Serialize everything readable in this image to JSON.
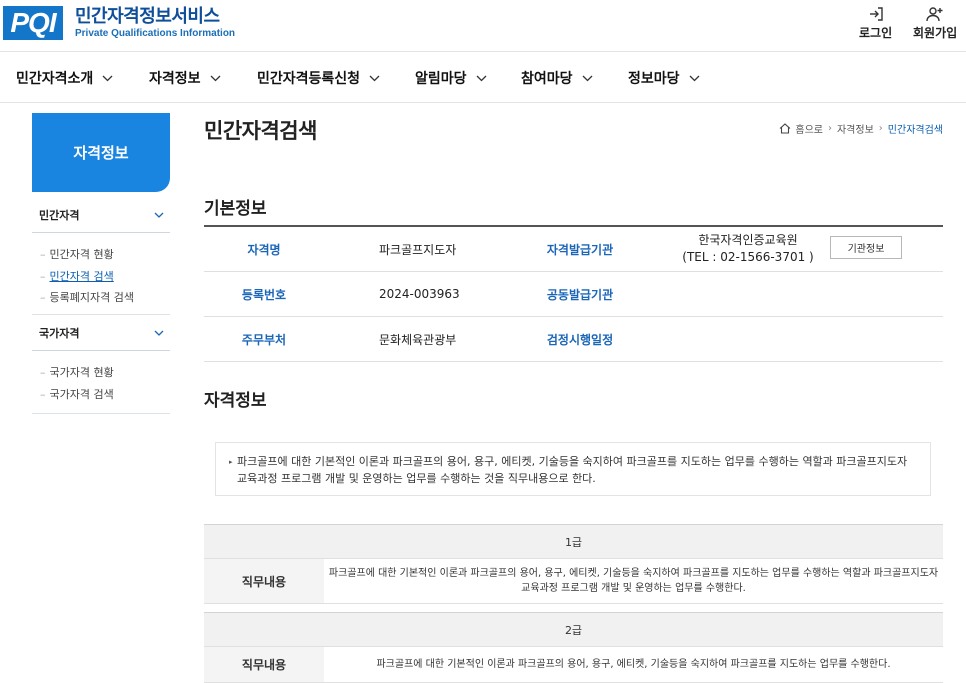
{
  "header": {
    "logo_mark": "PQI",
    "title": "민간자격정보서비스",
    "subtitle": "Private Qualifications Information",
    "login_label": "로그인",
    "join_label": "회원가입"
  },
  "nav": {
    "items": [
      {
        "label": "민간자격소개"
      },
      {
        "label": "자격정보"
      },
      {
        "label": "민간자격등록신청"
      },
      {
        "label": "알림마당"
      },
      {
        "label": "참여마당"
      },
      {
        "label": "정보마당"
      }
    ]
  },
  "sidebar": {
    "title": "자격정보",
    "groups": [
      {
        "label": "민간자격",
        "items": [
          "민간자격 현황",
          "민간자격 검색",
          "등록폐지자격 검색"
        ],
        "active_index": 1
      },
      {
        "label": "국가자격",
        "items": [
          "국가자격 현황",
          "국가자격 검색"
        ]
      }
    ]
  },
  "page": {
    "title": "민간자격검색",
    "breadcrumb": [
      "홈으로",
      "자격정보",
      "민간자격검색"
    ]
  },
  "basic_info": {
    "heading": "기본정보",
    "rows": [
      {
        "label1": "자격명",
        "value1": "파크골프지도자",
        "label2": "자격발급기관",
        "org_name": "한국자격인증교육원",
        "org_tel": "(TEL : 02-1566-3701 )",
        "org_button": "기관정보"
      },
      {
        "label1": "등록번호",
        "value1": "2024-003963",
        "label2": "공동발급기관"
      },
      {
        "label1": "주무부처",
        "value1": "문화체육관광부",
        "label2": "검정시행일정"
      }
    ]
  },
  "qual_info": {
    "heading": "자격정보",
    "description": "파크골프에 대한 기본적인 이론과 파크골프의 용어, 용구, 에티켓, 기술등을 숙지하여 파크골프를 지도하는 업무를 수행하는 역할과 파크골프지도자 교육과정 프로그램 개발 및 운영하는 업무를 수행하는 것을 직무내용으로 한다.",
    "grades": [
      {
        "grade": "1급",
        "label": "직무내용",
        "content": "파크골프에 대한 기본적인 이론과 파크골프의 용어, 용구, 에티켓, 기술등을 숙지하여 파크골프를 지도하는 업무를 수행하는 역할과 파크골프지도자 교육과정 프로그램 개발 및 운영하는 업무를 수행한다."
      },
      {
        "grade": "2급",
        "label": "직무내용",
        "content": "파크골프에 대한 기본적인 이론과 파크골프의 용어, 용구, 에티켓, 기술등을 숙지하여 파크골프를 지도하는 업무를 수행한다."
      }
    ]
  },
  "colors": {
    "brand": "#1476c8",
    "sidebar_head": "#1a85e0",
    "label_blue": "#1b66b8"
  },
  "icons": {
    "login": "login-arrow-icon",
    "join": "user-plus-icon",
    "home": "home-icon",
    "chevron": "chevron-down-icon"
  }
}
